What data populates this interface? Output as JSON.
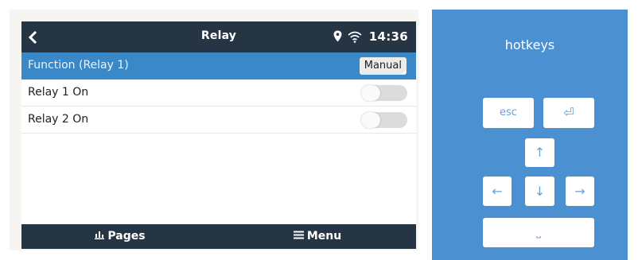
{
  "device": {
    "title": "Relay",
    "time": "14:36",
    "status_icons": [
      "location-icon",
      "wifi-icon"
    ],
    "rows": [
      {
        "label": "Function (Relay 1)",
        "value": "Manual",
        "selected": true
      },
      {
        "label": "Relay 1 On",
        "switch_state": "off"
      },
      {
        "label": "Relay 2 On",
        "switch_state": "off"
      }
    ],
    "bottom": {
      "pages_label": "Pages",
      "menu_label": "Menu"
    }
  },
  "hotkeys": {
    "title": "hotkeys",
    "keys": {
      "esc": "esc",
      "enter": "⏎",
      "up": "↑",
      "left": "←",
      "down": "↓",
      "right": "→",
      "space": "⎵"
    }
  },
  "colors": {
    "topbar": "#253544",
    "selected_row": "#3b88c8",
    "hotkeys_panel": "#4b90d1",
    "key_glyph": "#6aa0d8"
  }
}
